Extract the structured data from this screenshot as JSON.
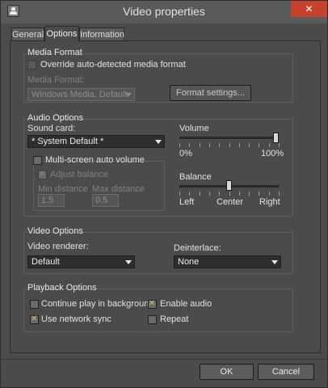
{
  "window": {
    "title": "Video properties",
    "close_glyph": "✕"
  },
  "tabs": [
    {
      "label": "General"
    },
    {
      "label": "Options"
    },
    {
      "label": "Information"
    }
  ],
  "media_format": {
    "group_title": "Media Format",
    "override_label": "Override auto-detected media format",
    "override_checked": false,
    "format_label": "Media Format:",
    "format_value": "Windows Media, Default",
    "format_settings_button": "Format settings..."
  },
  "audio": {
    "group_title": "Audio Options",
    "sound_card_label": "Sound card:",
    "sound_card_value": "* System Default *",
    "multi_screen_label": "Multi-screen auto volume",
    "multi_screen_checked": false,
    "adjust_balance_label": "Adjust balance",
    "adjust_balance_checked": true,
    "min_distance_label": "Min distance",
    "min_distance_value": "1.5",
    "max_distance_label": "Max distance",
    "max_distance_value": "0.5",
    "volume_label": "Volume",
    "volume_min": "0%",
    "volume_max": "100%",
    "volume_level": 1.0,
    "balance_label": "Balance",
    "balance_left": "Left",
    "balance_center": "Center",
    "balance_right": "Right",
    "balance_level": 0.5
  },
  "video": {
    "group_title": "Video Options",
    "renderer_label": "Video renderer:",
    "renderer_value": "Default",
    "deinterlace_label": "Deinterlace:",
    "deinterlace_value": "None"
  },
  "playback": {
    "group_title": "Playback Options",
    "continue_label": "Continue play in background",
    "continue_checked": false,
    "enable_audio_label": "Enable audio",
    "enable_audio_checked": true,
    "network_sync_label": "Use network sync",
    "network_sync_checked": true,
    "repeat_label": "Repeat",
    "repeat_checked": false
  },
  "footer": {
    "ok_label": "OK",
    "cancel_label": "Cancel"
  },
  "colors": {
    "close_button": "#c7412f",
    "check_mark": "#d9b56b",
    "background": "#4b4b4b"
  },
  "icons": {
    "app": "app-user-icon",
    "close": "close-icon",
    "dropdown": "chevron-down-icon"
  }
}
